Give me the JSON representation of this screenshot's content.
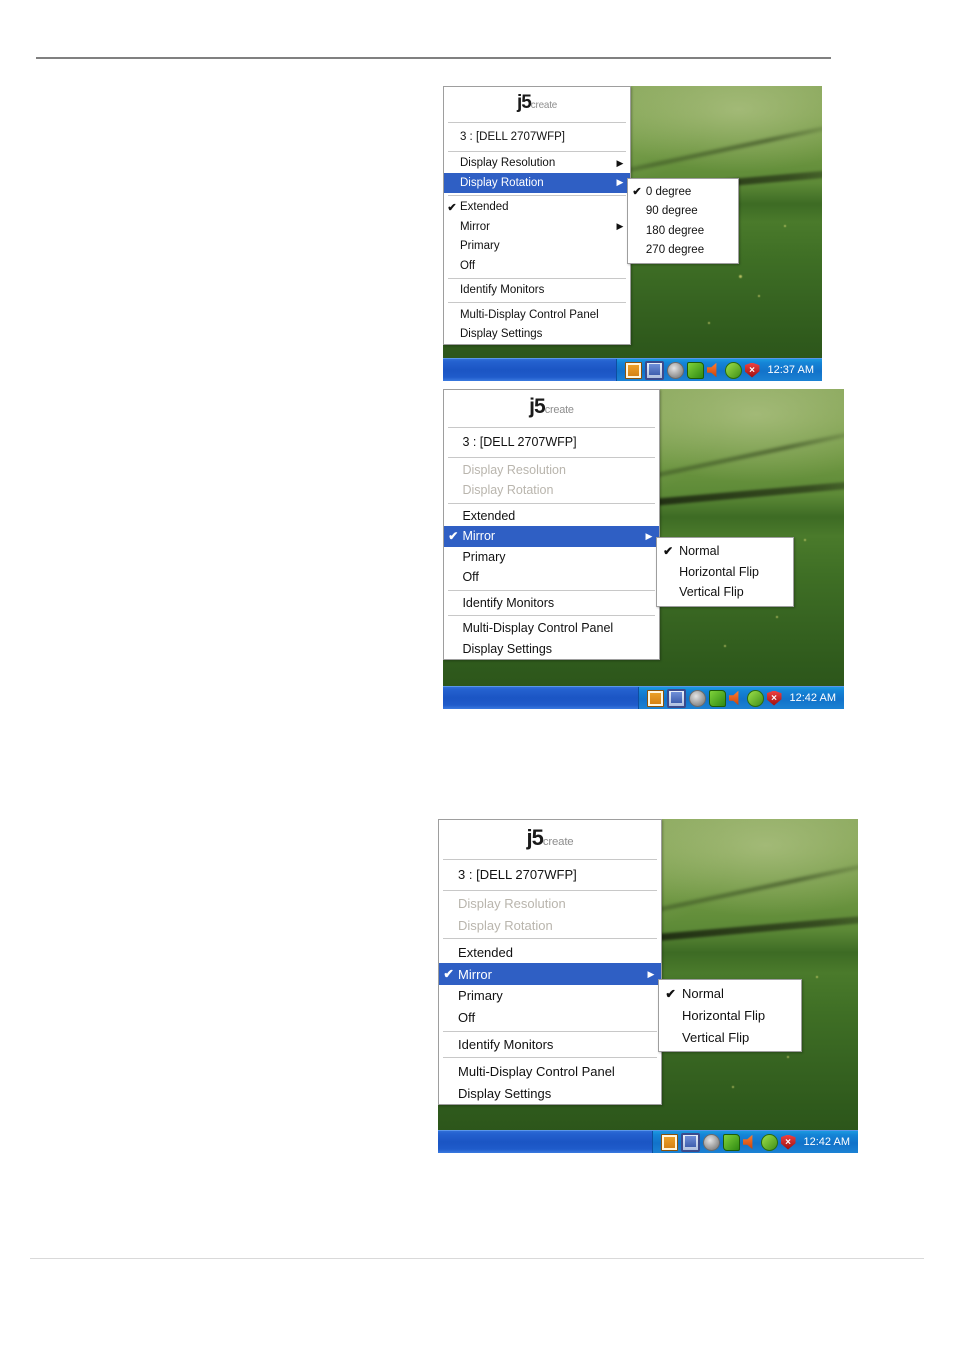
{
  "page": {
    "background_color": "#ffffff",
    "top_rule_color": "#808080",
    "bottom_rule_color": "#d9d9d9"
  },
  "theme": {
    "menu_background": "#ffffff",
    "menu_border": "#9e9e9e",
    "menu_text": "#111111",
    "menu_disabled_text": "#b9b5ad",
    "menu_highlight": "#2f5fc4",
    "menu_highlight_text": "#ffffff",
    "separator": "#c8c8c8",
    "taskbar_blue": "#1b55c4",
    "tray_blue": "#1272c9",
    "clock_text": "#ffffff",
    "desktop_green": "#4a7a2b"
  },
  "logo": {
    "mark": "j5",
    "word": "create"
  },
  "icons": {
    "submenu_arrow": "▶",
    "checkmark": "✔",
    "tray": [
      "network-icon",
      "display-adapter-icon",
      "speaker-gray-icon",
      "green-arrow-icon",
      "volume-icon",
      "nvidia-icon",
      "security-shield-icon"
    ]
  },
  "screenshots": [
    {
      "id": "screenshot-rotation",
      "device_label": "3 : [DELL 2707WFP]",
      "clock": "12:37 AM",
      "menu_items": [
        {
          "label": "Display Resolution",
          "checked": false,
          "submenu": true,
          "disabled": false,
          "selected": false
        },
        {
          "label": "Display Rotation",
          "checked": false,
          "submenu": true,
          "disabled": false,
          "selected": true
        },
        {
          "label": "Extended",
          "checked": true,
          "submenu": false,
          "disabled": false,
          "selected": false
        },
        {
          "label": "Mirror",
          "checked": false,
          "submenu": true,
          "disabled": false,
          "selected": false
        },
        {
          "label": "Primary",
          "checked": false,
          "submenu": false,
          "disabled": false,
          "selected": false
        },
        {
          "label": "Off",
          "checked": false,
          "submenu": false,
          "disabled": false,
          "selected": false
        },
        {
          "label": "Identify Monitors",
          "checked": false,
          "submenu": false,
          "disabled": false,
          "selected": false
        },
        {
          "label": "Multi-Display Control Panel",
          "checked": false,
          "submenu": false,
          "disabled": false,
          "selected": false
        },
        {
          "label": "Display Settings",
          "checked": false,
          "submenu": false,
          "disabled": false,
          "selected": false
        }
      ],
      "submenu": {
        "name": "display-rotation-submenu",
        "items": [
          {
            "label": "0 degree",
            "checked": true
          },
          {
            "label": "90 degree",
            "checked": false
          },
          {
            "label": "180 degree",
            "checked": false
          },
          {
            "label": "270 degree",
            "checked": false
          }
        ]
      }
    },
    {
      "id": "screenshot-mirror-a",
      "device_label": "3 : [DELL 2707WFP]",
      "clock": "12:42 AM",
      "menu_items": [
        {
          "label": "Display Resolution",
          "checked": false,
          "submenu": false,
          "disabled": true,
          "selected": false
        },
        {
          "label": "Display Rotation",
          "checked": false,
          "submenu": false,
          "disabled": true,
          "selected": false
        },
        {
          "label": "Extended",
          "checked": false,
          "submenu": false,
          "disabled": false,
          "selected": false
        },
        {
          "label": "Mirror",
          "checked": true,
          "submenu": true,
          "disabled": false,
          "selected": true
        },
        {
          "label": "Primary",
          "checked": false,
          "submenu": false,
          "disabled": false,
          "selected": false
        },
        {
          "label": "Off",
          "checked": false,
          "submenu": false,
          "disabled": false,
          "selected": false
        },
        {
          "label": "Identify Monitors",
          "checked": false,
          "submenu": false,
          "disabled": false,
          "selected": false
        },
        {
          "label": "Multi-Display Control Panel",
          "checked": false,
          "submenu": false,
          "disabled": false,
          "selected": false
        },
        {
          "label": "Display Settings",
          "checked": false,
          "submenu": false,
          "disabled": false,
          "selected": false
        }
      ],
      "submenu": {
        "name": "mirror-submenu",
        "items": [
          {
            "label": "Normal",
            "checked": true
          },
          {
            "label": "Horizontal Flip",
            "checked": false
          },
          {
            "label": "Vertical Flip",
            "checked": false
          }
        ]
      }
    },
    {
      "id": "screenshot-mirror-b",
      "device_label": "3 : [DELL 2707WFP]",
      "clock": "12:42 AM",
      "menu_items": [
        {
          "label": "Display Resolution",
          "checked": false,
          "submenu": false,
          "disabled": true,
          "selected": false
        },
        {
          "label": "Display Rotation",
          "checked": false,
          "submenu": false,
          "disabled": true,
          "selected": false
        },
        {
          "label": "Extended",
          "checked": false,
          "submenu": false,
          "disabled": false,
          "selected": false
        },
        {
          "label": "Mirror",
          "checked": true,
          "submenu": true,
          "disabled": false,
          "selected": true
        },
        {
          "label": "Primary",
          "checked": false,
          "submenu": false,
          "disabled": false,
          "selected": false
        },
        {
          "label": "Off",
          "checked": false,
          "submenu": false,
          "disabled": false,
          "selected": false
        },
        {
          "label": "Identify Monitors",
          "checked": false,
          "submenu": false,
          "disabled": false,
          "selected": false
        },
        {
          "label": "Multi-Display Control Panel",
          "checked": false,
          "submenu": false,
          "disabled": false,
          "selected": false
        },
        {
          "label": "Display Settings",
          "checked": false,
          "submenu": false,
          "disabled": false,
          "selected": false
        }
      ],
      "submenu": {
        "name": "mirror-submenu",
        "items": [
          {
            "label": "Normal",
            "checked": true
          },
          {
            "label": "Horizontal Flip",
            "checked": false
          },
          {
            "label": "Vertical Flip",
            "checked": false
          }
        ]
      }
    }
  ]
}
